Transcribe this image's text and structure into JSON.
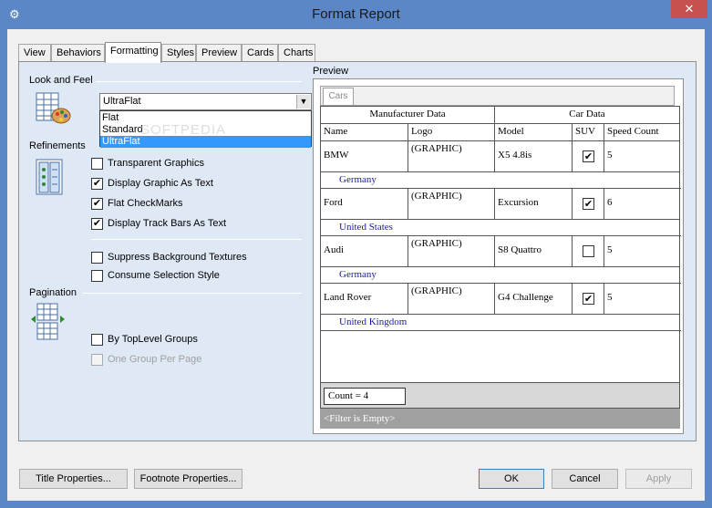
{
  "window": {
    "title": "Format Report"
  },
  "tabs": [
    "View",
    "Behaviors",
    "Formatting",
    "Styles",
    "Preview",
    "Cards",
    "Charts"
  ],
  "look_and_feel": {
    "heading": "Look and Feel",
    "selected": "UltraFlat",
    "options": [
      "Flat",
      "Standard",
      "UltraFlat"
    ],
    "watermark": "SOFTPEDIA"
  },
  "refinements": {
    "heading": "Refinements",
    "transparent_graphics": "Transparent Graphics",
    "display_graphic_as_text": "Display Graphic As Text",
    "flat_checkmarks": "Flat CheckMarks",
    "display_trackbars_as_text": "Display Track Bars As Text",
    "suppress_bg_textures": "Suppress Background Textures",
    "consume_selection_style": "Consume Selection Style"
  },
  "pagination": {
    "heading": "Pagination",
    "by_toplevel_groups": "By TopLevel Groups",
    "one_group_per_page": "One Group Per Page"
  },
  "preview": {
    "heading": "Preview",
    "tab": "Cars",
    "band_headers": [
      "Manufacturer Data",
      "Car Data"
    ],
    "columns": [
      "Name",
      "Logo",
      "Model",
      "SUV",
      "Speed Count"
    ],
    "rows": [
      {
        "name": "BMW",
        "logo": "(GRAPHIC)",
        "model": "X5 4.8is",
        "suv": true,
        "speed": "5",
        "country": "Germany"
      },
      {
        "name": "Ford",
        "logo": "(GRAPHIC)",
        "model": "Excursion",
        "suv": true,
        "speed": "6",
        "country": "United States"
      },
      {
        "name": "Audi",
        "logo": "(GRAPHIC)",
        "model": "S8 Quattro",
        "suv": false,
        "speed": "5",
        "country": "Germany"
      },
      {
        "name": "Land Rover",
        "logo": "(GRAPHIC)",
        "model": "G4 Challenge",
        "suv": true,
        "speed": "5",
        "country": "United Kingdom"
      }
    ],
    "count": "Count = 4",
    "filter": "<Filter is Empty>"
  },
  "buttons": {
    "title_properties": "Title Properties...",
    "footnote_properties": "Footnote Properties...",
    "ok": "OK",
    "cancel": "Cancel",
    "apply": "Apply"
  },
  "colors": {
    "accent": "#5b87c7",
    "selection": "#3399ff",
    "country_text": "#1a1aa6"
  },
  "icons": {
    "system": "gear-icon",
    "close": "close-icon"
  }
}
